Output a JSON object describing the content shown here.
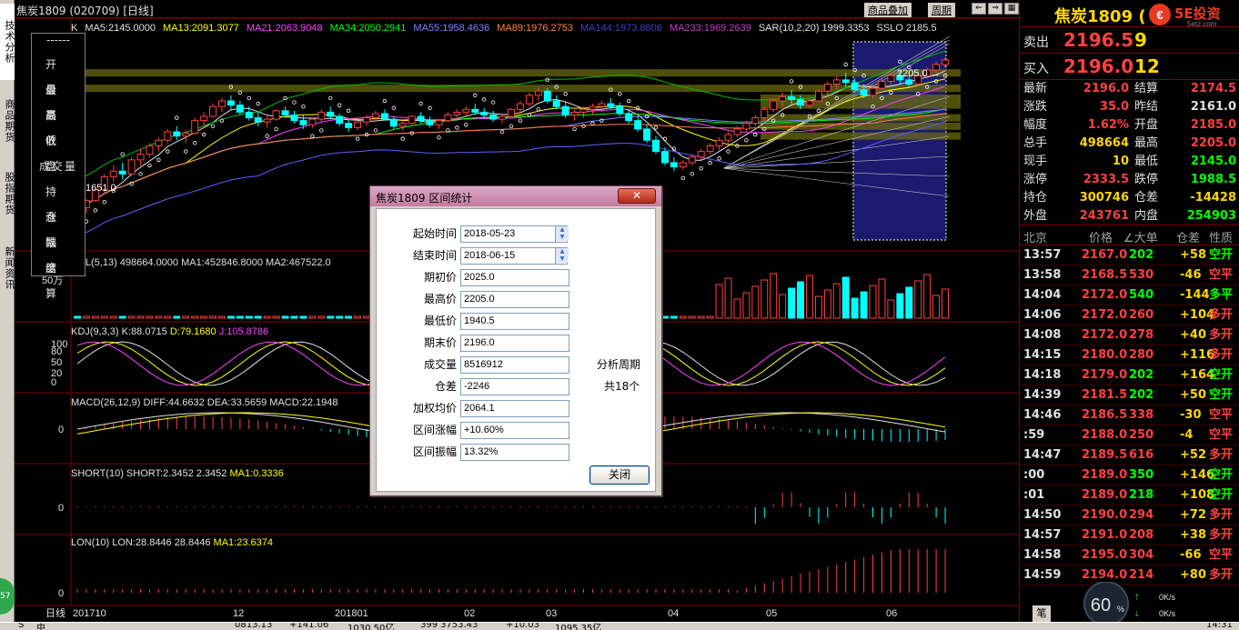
{
  "window": {
    "title": "焦炭1809 (020709) [日线]",
    "links": [
      "商品叠加",
      "周期"
    ]
  },
  "left_tabs": [
    "技术分析",
    "商品期货",
    "股指期货",
    "新闻资讯"
  ],
  "ohlc_panel": {
    "rows": [
      "开 盘",
      "最 高",
      "最 低",
      "收 盘",
      "成交量",
      "持 仓",
      "涨 跌",
      "幅 度",
      "结 算"
    ]
  },
  "main_chart": {
    "indicator_line": [
      {
        "text": "K",
        "color": "#e0e0e0"
      },
      {
        "text": "MA5:2145.0000",
        "color": "#e0e0e0"
      },
      {
        "text": "MA13:2091.3077",
        "color": "#ffff00"
      },
      {
        "text": "MA21:2063.9048",
        "color": "#ff40ff"
      },
      {
        "text": "MA34:2050.2941",
        "color": "#00ff00"
      },
      {
        "text": "MA55:1958.4636",
        "color": "#8080ff"
      },
      {
        "text": "MA89:1976.2753",
        "color": "#ff8040"
      },
      {
        "text": "MA144:1973.8806",
        "color": "#4040c0"
      },
      {
        "text": "MA233:1969.2639",
        "color": "#c040c0"
      },
      {
        "text": "SAR(10,2,20) 1999.3353",
        "color": "#e0e0e0"
      },
      {
        "text": "SSLO 2185.5",
        "color": "#e0e0e0"
      }
    ],
    "high_marker": "2205.0",
    "low_marker": "1651.0",
    "candles": [
      [
        1690,
        1705,
        1655,
        1670
      ],
      [
        1670,
        1700,
        1651,
        1695
      ],
      [
        1695,
        1740,
        1690,
        1735
      ],
      [
        1735,
        1790,
        1720,
        1780
      ],
      [
        1780,
        1820,
        1760,
        1800
      ],
      [
        1800,
        1830,
        1770,
        1790
      ],
      [
        1790,
        1850,
        1785,
        1840
      ],
      [
        1840,
        1880,
        1820,
        1860
      ],
      [
        1860,
        1900,
        1850,
        1890
      ],
      [
        1890,
        1920,
        1870,
        1910
      ],
      [
        1910,
        1950,
        1900,
        1940
      ],
      [
        1940,
        1960,
        1910,
        1925
      ],
      [
        1925,
        1945,
        1900,
        1935
      ],
      [
        1935,
        1990,
        1930,
        1980
      ],
      [
        1980,
        2010,
        1960,
        1995
      ],
      [
        1995,
        2040,
        1990,
        2030
      ],
      [
        2030,
        2060,
        2010,
        2050
      ],
      [
        2050,
        2070,
        2020,
        2035
      ],
      [
        2035,
        2050,
        2000,
        2010
      ],
      [
        2010,
        2030,
        1980,
        1990
      ],
      [
        1990,
        2010,
        1960,
        1975
      ],
      [
        1975,
        1995,
        1955,
        1985
      ],
      [
        1985,
        2020,
        1980,
        2015
      ],
      [
        2015,
        2030,
        1990,
        2000
      ],
      [
        2000,
        2015,
        1970,
        1980
      ],
      [
        1980,
        2000,
        1950,
        1965
      ],
      [
        1965,
        1990,
        1955,
        1985
      ],
      [
        1985,
        2020,
        1975,
        2010
      ],
      [
        2010,
        2030,
        1985,
        1995
      ],
      [
        1995,
        2005,
        1960,
        1970
      ],
      [
        1970,
        1985,
        1940,
        1955
      ],
      [
        1955,
        1980,
        1945,
        1975
      ],
      [
        1975,
        2000,
        1960,
        1990
      ],
      [
        1990,
        2015,
        1975,
        2005
      ],
      [
        2005,
        2020,
        1980,
        1985
      ],
      [
        1985,
        1995,
        1950,
        1960
      ],
      [
        1960,
        1980,
        1945,
        1970
      ],
      [
        1970,
        2000,
        1965,
        1995
      ],
      [
        1995,
        2010,
        1970,
        1980
      ],
      [
        1980,
        1995,
        1955,
        1965
      ],
      [
        1965,
        1985,
        1950,
        1980
      ],
      [
        1980,
        2010,
        1975,
        2000
      ],
      [
        2000,
        2020,
        1985,
        2010
      ],
      [
        2010,
        2030,
        1995,
        2020
      ],
      [
        2020,
        2040,
        2000,
        2010
      ],
      [
        2010,
        2025,
        1990,
        2000
      ],
      [
        2000,
        2015,
        1975,
        1985
      ],
      [
        1985,
        2005,
        1970,
        1995
      ],
      [
        1995,
        2025,
        1990,
        2020
      ],
      [
        2020,
        2050,
        2010,
        2040
      ],
      [
        2040,
        2080,
        2030,
        2070
      ],
      [
        2070,
        2100,
        2050,
        2085
      ],
      [
        2085,
        2095,
        2040,
        2050
      ],
      [
        2050,
        2070,
        2020,
        2030
      ],
      [
        2030,
        2045,
        1990,
        2000
      ],
      [
        2000,
        2020,
        1980,
        2010
      ],
      [
        2010,
        2030,
        1990,
        2020
      ],
      [
        2020,
        2040,
        2000,
        2030
      ],
      [
        2030,
        2050,
        2010,
        2040
      ],
      [
        2040,
        2060,
        2020,
        2030
      ],
      [
        2030,
        2045,
        1995,
        2005
      ],
      [
        2005,
        2020,
        1970,
        1980
      ],
      [
        1980,
        1995,
        1940,
        1950
      ],
      [
        1950,
        1965,
        1900,
        1910
      ],
      [
        1910,
        1925,
        1860,
        1870
      ],
      [
        1870,
        1885,
        1820,
        1830
      ],
      [
        1830,
        1850,
        1800,
        1815
      ],
      [
        1815,
        1840,
        1805,
        1830
      ],
      [
        1830,
        1860,
        1820,
        1850
      ],
      [
        1850,
        1880,
        1840,
        1870
      ],
      [
        1870,
        1900,
        1860,
        1890
      ],
      [
        1890,
        1920,
        1875,
        1910
      ],
      [
        1910,
        1940,
        1900,
        1930
      ],
      [
        1930,
        1960,
        1920,
        1950
      ],
      [
        1950,
        1980,
        1940,
        1970
      ],
      [
        1970,
        2000,
        1960,
        1990
      ],
      [
        1990,
        2030,
        1980,
        2020
      ],
      [
        2020,
        2060,
        2010,
        2050
      ],
      [
        2050,
        2080,
        2030,
        2065
      ],
      [
        2065,
        2090,
        2040,
        2055
      ],
      [
        2055,
        2070,
        2020,
        2035
      ],
      [
        2035,
        2060,
        2025,
        2050
      ],
      [
        2050,
        2090,
        2045,
        2085
      ],
      [
        2085,
        2120,
        2070,
        2110
      ],
      [
        2110,
        2140,
        2090,
        2125
      ],
      [
        2125,
        2150,
        2100,
        2115
      ],
      [
        2115,
        2130,
        2080,
        2090
      ],
      [
        2090,
        2110,
        2060,
        2070
      ],
      [
        2070,
        2100,
        2060,
        2095
      ],
      [
        2095,
        2130,
        2090,
        2120
      ],
      [
        2120,
        2150,
        2110,
        2140
      ],
      [
        2140,
        2160,
        2110,
        2125
      ],
      [
        2125,
        2140,
        2100,
        2110
      ],
      [
        2110,
        2145,
        2105,
        2140
      ],
      [
        2140,
        2170,
        2130,
        2160
      ],
      [
        2160,
        2190,
        2150,
        2180
      ],
      [
        2180,
        2205,
        2170,
        2196
      ]
    ]
  },
  "vol_panel": {
    "label": "VOL(5,13)  498664.0000  MA1:452846.8000  MA2:467522.0",
    "axis_label": "50万"
  },
  "kdj_panel": {
    "label_prefix": "KDJ(9,3,3)",
    "k": "K:88.0715",
    "d": "D:79.1680",
    "j": "J:105.8786",
    "ticks": [
      "100",
      "80",
      "50",
      "20",
      "0"
    ]
  },
  "macd_panel": {
    "label": "MACD(26,12,9)  DIFF:44.6632  DEA:33.5659  MACD:22.1948",
    "zero": "0"
  },
  "short_panel": {
    "label_prefix": "SHORT(10)",
    "label_values": "SHORT:2.3452  2.3452",
    "label_ma": "MA1:0.3336",
    "zero": "0"
  },
  "lon_panel": {
    "label_prefix": "LON(10)",
    "label_values": "LON:28.8446  28.8446",
    "label_ma": "MA1:23.6374",
    "zero": "0"
  },
  "x_axis": {
    "period_label": "日线",
    "ticks": [
      "201710",
      "12",
      "201801",
      "02",
      "03",
      "04",
      "05",
      "06"
    ]
  },
  "right_panel": {
    "title": "焦炭1809 (",
    "logo_text": "5E投资",
    "logo_sub": "5etz.com",
    "ask": {
      "label": "卖出",
      "price": "2196.5",
      "volume": "9"
    },
    "bid": {
      "label": "买入",
      "price": "2196.0",
      "volume": "12"
    },
    "stats": [
      {
        "k1": "最新",
        "v1": "2196.0",
        "c1": "#ff4040",
        "k2": "结算",
        "v2": "2174.5",
        "c2": "#ff4040"
      },
      {
        "k1": "涨跌",
        "v1": "35.0",
        "c1": "#ff4040",
        "k2": "昨结",
        "v2": "2161.0",
        "c2": "#e0e0e0"
      },
      {
        "k1": "幅度",
        "v1": "1.62%",
        "c1": "#ff4040",
        "k2": "开盘",
        "v2": "2185.0",
        "c2": "#ff4040"
      },
      {
        "k1": "总手",
        "v1": "498664",
        "c1": "#ffd700",
        "k2": "最高",
        "v2": "2205.0",
        "c2": "#ff4040"
      },
      {
        "k1": "现手",
        "v1": "10",
        "c1": "#ffd700",
        "k2": "最低",
        "v2": "2145.0",
        "c2": "#00ff00"
      },
      {
        "k1": "涨停",
        "v1": "2333.5",
        "c1": "#ff4040",
        "k2": "跌停",
        "v2": "1988.5",
        "c2": "#00ff00"
      },
      {
        "k1": "持仓",
        "v1": "300746",
        "c1": "#ffd700",
        "k2": "仓差",
        "v2": "-14428",
        "c2": "#ffd700"
      },
      {
        "k1": "外盘",
        "v1": "243761",
        "c1": "#ff4040",
        "k2": "内盘",
        "v2": "254903",
        "c2": "#00ff00"
      }
    ],
    "tick_header": [
      "北京",
      "价格",
      "∠大单",
      "仓差",
      "性质"
    ],
    "ticks": [
      {
        "time": "13:57",
        "price": "2167.0",
        "vol": "202",
        "vc": "#00ff00",
        "diff": "+58",
        "kind": "空开",
        "kc": "#00ff00"
      },
      {
        "time": "13:58",
        "price": "2168.5",
        "vol": "530",
        "vc": "#ff4040",
        "diff": "-46",
        "kind": "空平",
        "kc": "#ff4040"
      },
      {
        "time": "14:04",
        "price": "2172.0",
        "vol": "540",
        "vc": "#00ff00",
        "diff": "-144",
        "kind": "多平",
        "kc": "#00ff00"
      },
      {
        "time": "14:06",
        "price": "2172.0",
        "vol": "260",
        "vc": "#ff4040",
        "diff": "+104",
        "kind": "多开",
        "kc": "#ff4040"
      },
      {
        "time": "14:08",
        "price": "2172.0",
        "vol": "278",
        "vc": "#ff4040",
        "diff": "+40",
        "kind": "多开",
        "kc": "#ff4040"
      },
      {
        "time": "14:15",
        "price": "2180.0",
        "vol": "280",
        "vc": "#ff4040",
        "diff": "+116",
        "kind": "多开",
        "kc": "#ff4040"
      },
      {
        "time": "14:18",
        "price": "2179.0",
        "vol": "202",
        "vc": "#00ff00",
        "diff": "+164",
        "kind": "空开",
        "kc": "#00ff00"
      },
      {
        "time": "14:39",
        "price": "2181.5",
        "vol": "202",
        "vc": "#00ff00",
        "diff": "+50",
        "kind": "空开",
        "kc": "#00ff00"
      },
      {
        "time": "14:46",
        "price": "2186.5",
        "vol": "338",
        "vc": "#ff4040",
        "diff": "-30",
        "kind": "空平",
        "kc": "#ff4040"
      },
      {
        "time": ":59",
        "price": "2188.0",
        "vol": "250",
        "vc": "#ff4040",
        "diff": "-4",
        "kind": "空平",
        "kc": "#ff4040"
      },
      {
        "time": "14:47",
        "price": "2189.5",
        "vol": "616",
        "vc": "#ff4040",
        "diff": "+52",
        "kind": "多开",
        "kc": "#ff4040"
      },
      {
        "time": ":00",
        "price": "2189.0",
        "vol": "350",
        "vc": "#00ff00",
        "diff": "+146",
        "kind": "空开",
        "kc": "#00ff00"
      },
      {
        "time": ":01",
        "price": "2189.0",
        "vol": "218",
        "vc": "#00ff00",
        "diff": "+108",
        "kind": "空开",
        "kc": "#00ff00"
      },
      {
        "time": "14:50",
        "price": "2190.0",
        "vol": "294",
        "vc": "#ff4040",
        "diff": "+72",
        "kind": "多开",
        "kc": "#ff4040"
      },
      {
        "time": "14:57",
        "price": "2191.0",
        "vol": "208",
        "vc": "#ff4040",
        "diff": "+38",
        "kind": "多开",
        "kc": "#ff4040"
      },
      {
        "time": "14:58",
        "price": "2195.0",
        "vol": "304",
        "vc": "#ff4040",
        "diff": "-66",
        "kind": "空平",
        "kc": "#ff4040"
      },
      {
        "time": "14:59",
        "price": "2194.0",
        "vol": "214",
        "vc": "#ff4040",
        "diff": "+80",
        "kind": "多开",
        "kc": "#ff4040"
      }
    ],
    "footer_tab": "笔"
  },
  "dialog": {
    "title": "焦炭1809 区间统计",
    "close_x": "✕",
    "fields": [
      {
        "label": "起始时间",
        "value": "2018-05-23"
      },
      {
        "label": "结束时间",
        "value": "2018-06-15"
      },
      {
        "label": "期初价",
        "value": "2025.0"
      },
      {
        "label": "最高价",
        "value": "2205.0"
      },
      {
        "label": "最低价",
        "value": "1940.5"
      },
      {
        "label": "期末价",
        "value": "2196.0"
      },
      {
        "label": "成交量",
        "value": "8516912"
      },
      {
        "label": "仓差",
        "value": "-2246"
      },
      {
        "label": "加权均价",
        "value": "2064.1"
      },
      {
        "label": "区间涨幅",
        "value": "+10.60%"
      },
      {
        "label": "区间振幅",
        "value": "13.32%"
      }
    ],
    "period_label": "分析周期",
    "period_value": "共18个",
    "close_button": "关闭"
  },
  "speed_widget": {
    "percent": "60",
    "unit": "%",
    "up": "0K/s",
    "down": "0K/s"
  },
  "taskbar": {
    "items": [
      "S",
      "中",
      "0813.13",
      "+141.06",
      "1030.50亿",
      "399",
      "3753.43",
      "+10.03",
      "1095.35亿",
      "14:31"
    ]
  },
  "colors": {
    "up": "#ff4040",
    "down": "#00ff00",
    "bg": "#000000",
    "grid": "#800000",
    "highlight_box": "#1a1a6e"
  }
}
